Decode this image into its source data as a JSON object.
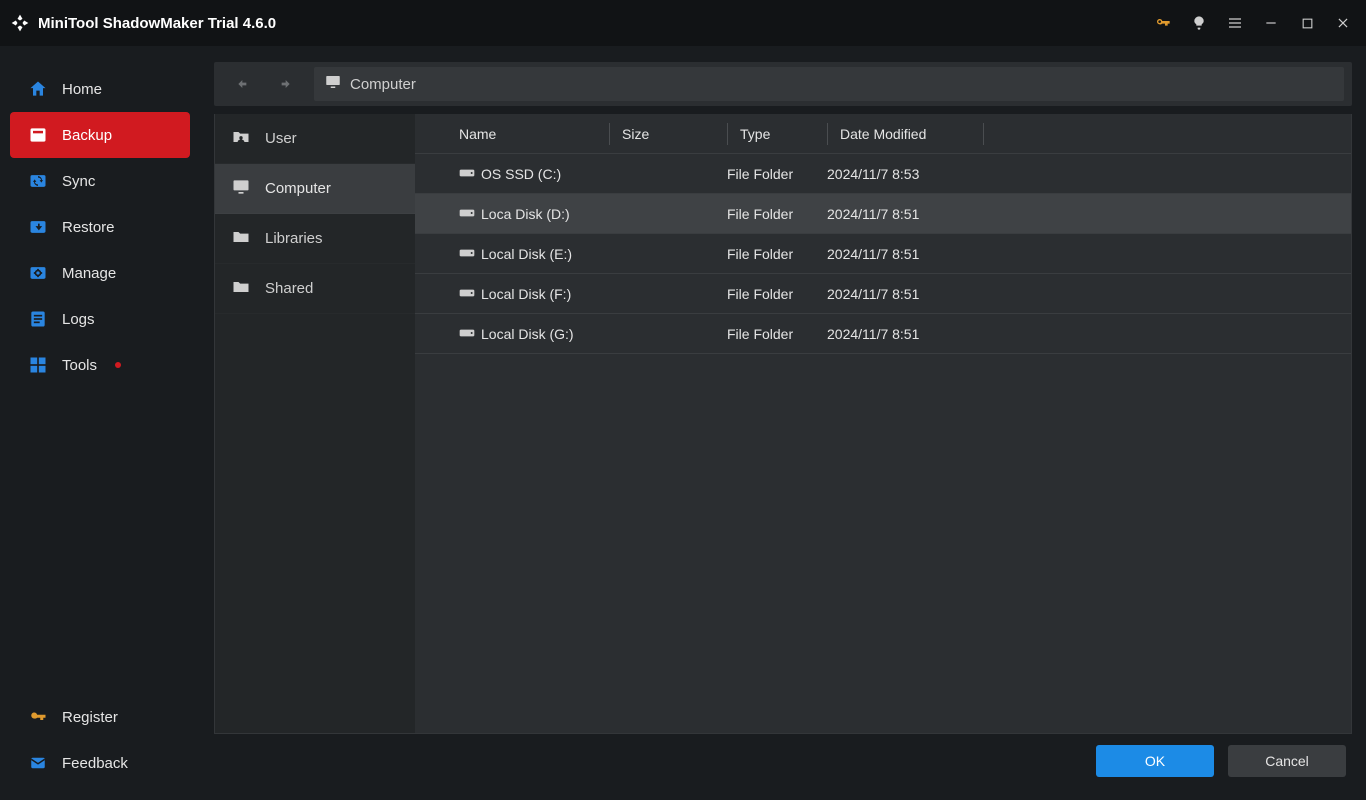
{
  "title": "MiniTool ShadowMaker Trial 4.6.0",
  "sidebar": {
    "items": [
      {
        "label": "Home"
      },
      {
        "label": "Backup"
      },
      {
        "label": "Sync"
      },
      {
        "label": "Restore"
      },
      {
        "label": "Manage"
      },
      {
        "label": "Logs"
      },
      {
        "label": "Tools"
      }
    ],
    "bottom": [
      {
        "label": "Register"
      },
      {
        "label": "Feedback"
      }
    ]
  },
  "crumb": {
    "label": "Computer"
  },
  "tree": {
    "items": [
      {
        "label": "User"
      },
      {
        "label": "Computer"
      },
      {
        "label": "Libraries"
      },
      {
        "label": "Shared"
      }
    ]
  },
  "columns": {
    "name": "Name",
    "size": "Size",
    "type": "Type",
    "date": "Date Modified"
  },
  "rows": [
    {
      "name": "OS SSD (C:)",
      "type": "File Folder",
      "date": "2024/11/7 8:53"
    },
    {
      "name": "Loca Disk (D:)",
      "type": "File Folder",
      "date": "2024/11/7 8:51"
    },
    {
      "name": "Local Disk (E:)",
      "type": "File Folder",
      "date": "2024/11/7 8:51"
    },
    {
      "name": "Local Disk (F:)",
      "type": "File Folder",
      "date": "2024/11/7 8:51"
    },
    {
      "name": "Local Disk (G:)",
      "type": "File Folder",
      "date": "2024/11/7 8:51"
    }
  ],
  "buttons": {
    "ok": "OK",
    "cancel": "Cancel"
  }
}
